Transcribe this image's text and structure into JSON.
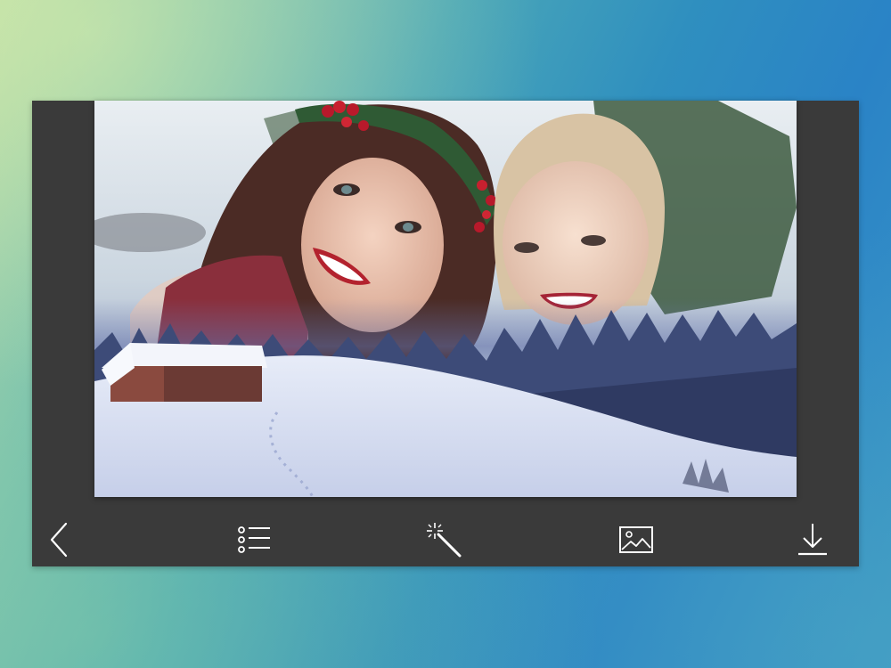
{
  "toolbar": {
    "buttons": [
      {
        "name": "back-button",
        "icon": "chevron-left-icon"
      },
      {
        "name": "frames-list-button",
        "icon": "list-icon"
      },
      {
        "name": "effects-button",
        "icon": "magic-wand-icon"
      },
      {
        "name": "gallery-button",
        "icon": "image-icon"
      },
      {
        "name": "download-button",
        "icon": "download-icon"
      }
    ]
  },
  "colors": {
    "panel": "#3a3a3a",
    "icon": "#ffffff"
  }
}
